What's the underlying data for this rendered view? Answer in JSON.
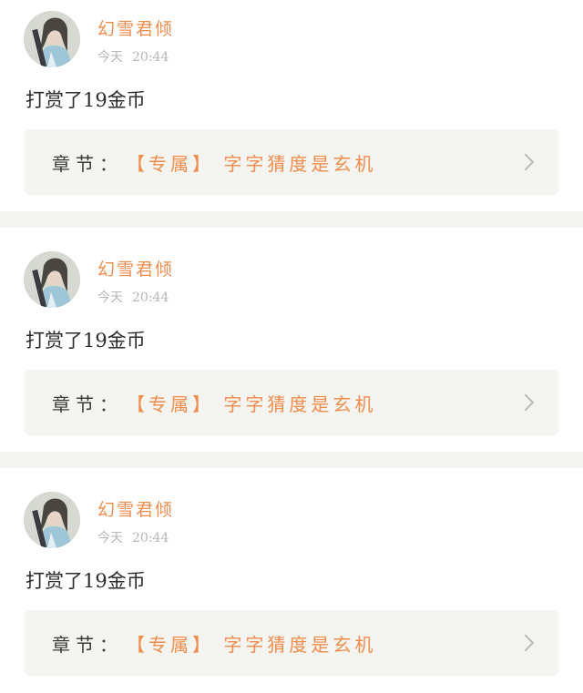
{
  "colors": {
    "accent": "#f08c4c",
    "background": "#f4f4f2",
    "card": "#ffffff",
    "chapter_box": "#f4f4f0",
    "muted": "#b6b6b6",
    "text": "#2b2b2b"
  },
  "items": [
    {
      "username": "幻雪君倾",
      "date_label": "今天",
      "time": "20:44",
      "reward_text": "打赏了19金币",
      "chapter": {
        "prefix": "章节：",
        "title": "【专属】 字字猜度是玄机",
        "arrow_icon": "chevron-right-icon"
      }
    },
    {
      "username": "幻雪君倾",
      "date_label": "今天",
      "time": "20:44",
      "reward_text": "打赏了19金币",
      "chapter": {
        "prefix": "章节：",
        "title": "【专属】 字字猜度是玄机",
        "arrow_icon": "chevron-right-icon"
      }
    },
    {
      "username": "幻雪君倾",
      "date_label": "今天",
      "time": "20:44",
      "reward_text": "打赏了19金币",
      "chapter": {
        "prefix": "章节：",
        "title": "【专属】 字字猜度是玄机",
        "arrow_icon": "chevron-right-icon"
      }
    }
  ]
}
